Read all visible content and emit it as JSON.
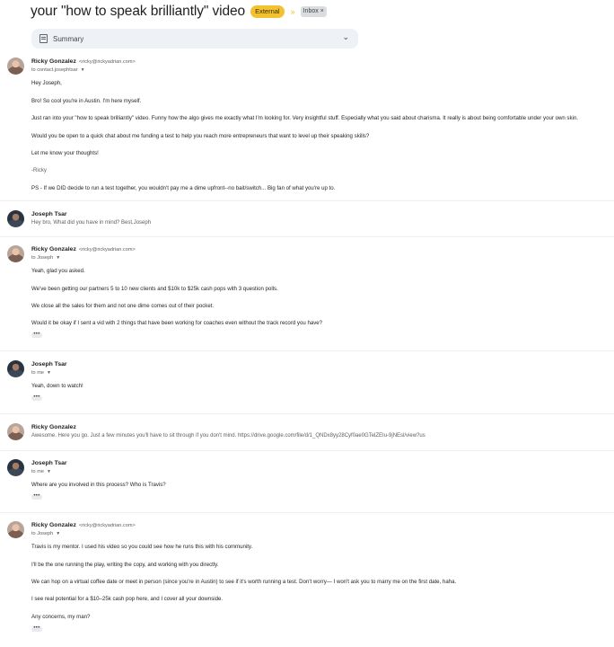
{
  "thread": {
    "subject": "your \"how to speak brilliantly\" video",
    "external_label": "External",
    "importance_marker": "»",
    "inbox_label": "Inbox",
    "inbox_remove": "×"
  },
  "summary": {
    "label": "Summary",
    "chevron": "⌄"
  },
  "icons": {
    "summary": "summary-doc-icon",
    "expand": "chevron-down-icon",
    "recipients": "caret-down-icon",
    "more": "more-dots-icon"
  },
  "messages": {
    "m1": {
      "sender": "Ricky Gonzalez",
      "email": "<ricky@rickyadrian.com>",
      "to": "to contact.josephtsar",
      "lines": [
        "Hey Joseph,",
        "Bro! So cool you're in Austin. I'm here myself.",
        "Just ran into your \"how to speak brilliantly\" video. Funny how the algo gives me exactly what I'm looking for. Very insightful stuff. Especially what you said about charisma. It really is about being comfortable under your own skin.",
        "Would you be open to a quick chat about me funding a test to help you reach more entrepreneurs that want to level up their speaking skills?",
        "Let me know your thoughts!",
        "-Ricky",
        "PS - If we DID decide to run a test together, you wouldn't pay me a dime upfront--no bait/switch... Big fan of what you're up to."
      ]
    },
    "m2": {
      "sender": "Joseph Tsar",
      "snippet": "Hey bro, What did you have in mind? Best,Joseph"
    },
    "m3": {
      "sender": "Ricky Gonzalez",
      "email": "<ricky@rickyadrian.com>",
      "to": "to Joseph",
      "lines": [
        "Yeah, glad you asked.",
        "We've been getting our partners 5 to 10 new clients and $10k to $25k cash pops with 3 question polls.",
        "We close all the sales for them and not one dime comes out of their pocket.",
        "Would it be okay if I sent a vid with 2 things that have been working for coaches even without the track record you have?"
      ],
      "dots": "•••"
    },
    "m4": {
      "sender": "Joseph Tsar",
      "to": "to me",
      "lines": [
        "Yeah, down to watch!"
      ],
      "dots": "•••"
    },
    "m5": {
      "sender": "Ricky Gonzalez",
      "snippet": "Awesome. Here you go. Just a few minutes you'll have to sit through if you don't mind. https://drive.google.com/file/d/1_QNDx8yy28Cyf0ae0GTelZEIu-9jNEsl/view?us"
    },
    "m6": {
      "sender": "Joseph Tsar",
      "to": "to me",
      "lines": [
        "Where are you involved in this process? Who is Travis?"
      ],
      "dots": "•••"
    },
    "m7": {
      "sender": "Ricky Gonzalez",
      "email": "<ricky@rickyadrian.com>",
      "to": "to Joseph",
      "lines": [
        "Travis is my mentor. I used his video so you could see how he runs this with his community.",
        "I'll be the one running the play, writing the copy, and working with you directly.",
        "We can hop on a virtual coffee date or meet in person (since you're in Austin) to see if it's worth running a test. Don't worry— I won't ask you to marry me on the first date, haha.",
        "I see real potential for a $10–25k cash pop here, and I cover all your downside.",
        "Any concerns, my man?"
      ],
      "dots": "•••"
    }
  }
}
